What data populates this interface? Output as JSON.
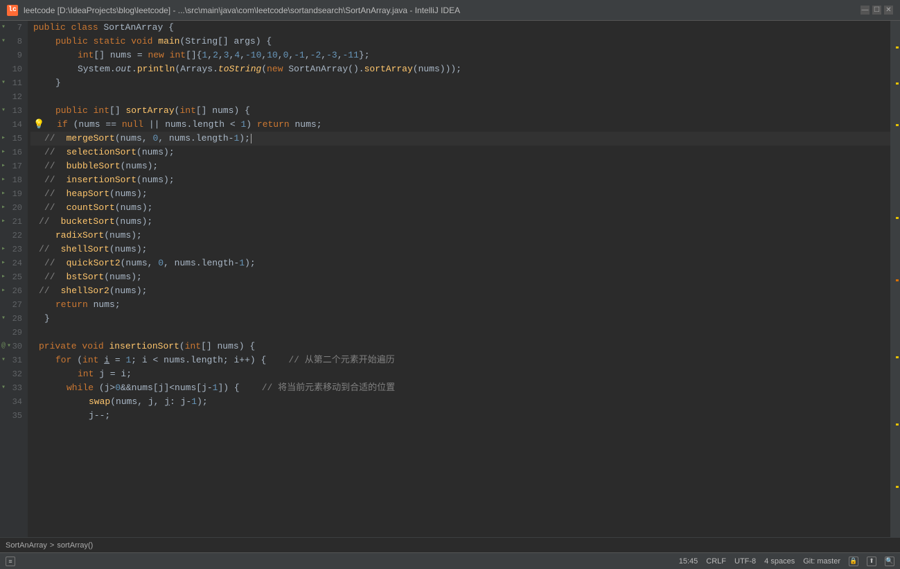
{
  "titlebar": {
    "title": "leetcode [D:\\IdeaProjects\\blog\\leetcode] - ...\\src\\main\\java\\com\\leetcode\\sortandsearch\\SortAnArray.java - IntelliJ IDEA",
    "icon_label": "lc",
    "controls": [
      "—",
      "☐",
      "✕"
    ]
  },
  "statusbar": {
    "time": "15:45",
    "encoding": "CRLF",
    "charset": "UTF-8",
    "indent": "4 spaces",
    "vcs": "Git: master"
  },
  "breadcrumb": {
    "class": "SortAnArray",
    "separator": ">",
    "method": "sortArray()"
  },
  "lines": [
    {
      "num": 7,
      "content": "public_class_SortAnArray",
      "type": "class_decl"
    },
    {
      "num": 8,
      "content": "public_static_void_main",
      "type": "main_decl"
    },
    {
      "num": 9,
      "content": "int_array_nums",
      "type": "nums_init"
    },
    {
      "num": 10,
      "content": "system_out",
      "type": "sysout"
    },
    {
      "num": 11,
      "content": "close_brace",
      "type": "brace"
    },
    {
      "num": 12,
      "content": "",
      "type": "empty"
    },
    {
      "num": 13,
      "content": "public_int_sortArray",
      "type": "sort_decl"
    },
    {
      "num": 14,
      "content": "if_null_check",
      "type": "null_check"
    },
    {
      "num": 15,
      "content": "mergeSort_commented",
      "type": "merge_commented"
    },
    {
      "num": 16,
      "content": "selectionSort_commented",
      "type": "selection_commented"
    },
    {
      "num": 17,
      "content": "bubbleSort_commented",
      "type": "bubble_commented"
    },
    {
      "num": 18,
      "content": "insertionSort_commented",
      "type": "insertion_commented"
    },
    {
      "num": 19,
      "content": "heapSort_commented",
      "type": "heap_commented"
    },
    {
      "num": 20,
      "content": "countSort_commented",
      "type": "count_commented"
    },
    {
      "num": 21,
      "content": "bucketSort_commented",
      "type": "bucket_commented"
    },
    {
      "num": 22,
      "content": "radixSort",
      "type": "radix_active"
    },
    {
      "num": 23,
      "content": "shellSort_commented",
      "type": "shell_commented"
    },
    {
      "num": 24,
      "content": "quickSort2_commented",
      "type": "quick_commented"
    },
    {
      "num": 25,
      "content": "bstSort_commented",
      "type": "bst_commented"
    },
    {
      "num": 26,
      "content": "shellSor2_commented",
      "type": "shell2_commented"
    },
    {
      "num": 27,
      "content": "return_nums",
      "type": "return"
    },
    {
      "num": 28,
      "content": "close_brace2",
      "type": "brace"
    },
    {
      "num": 29,
      "content": "",
      "type": "empty"
    },
    {
      "num": 30,
      "content": "private_void_insertionSort",
      "type": "insertion_decl"
    },
    {
      "num": 31,
      "content": "for_loop",
      "type": "for_loop"
    },
    {
      "num": 32,
      "content": "int_j_i",
      "type": "j_init"
    },
    {
      "num": 33,
      "content": "while_loop",
      "type": "while_loop"
    },
    {
      "num": 34,
      "content": "swap",
      "type": "swap"
    },
    {
      "num": 35,
      "content": "j_decrement",
      "type": "j_dec"
    }
  ]
}
